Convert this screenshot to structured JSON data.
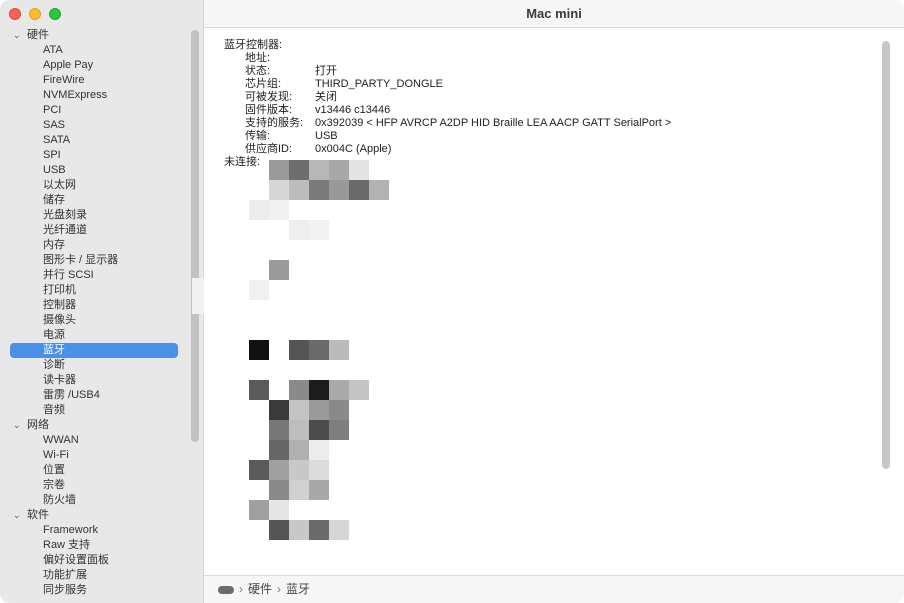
{
  "window": {
    "title": "Mac mini"
  },
  "sidebar": {
    "rows": [
      {
        "type": "group",
        "label": "硬件",
        "name": "sidebar-group-hardware"
      },
      {
        "type": "item",
        "label": "ATA",
        "name": "sidebar-item-ata"
      },
      {
        "type": "item",
        "label": "Apple Pay",
        "name": "sidebar-item-apple-pay"
      },
      {
        "type": "item",
        "label": "FireWire",
        "name": "sidebar-item-firewire"
      },
      {
        "type": "item",
        "label": "NVMExpress",
        "name": "sidebar-item-nvmexpress"
      },
      {
        "type": "item",
        "label": "PCI",
        "name": "sidebar-item-pci"
      },
      {
        "type": "item",
        "label": "SAS",
        "name": "sidebar-item-sas"
      },
      {
        "type": "item",
        "label": "SATA",
        "name": "sidebar-item-sata"
      },
      {
        "type": "item",
        "label": "SPI",
        "name": "sidebar-item-spi"
      },
      {
        "type": "item",
        "label": "USB",
        "name": "sidebar-item-usb"
      },
      {
        "type": "item",
        "label": "以太网",
        "name": "sidebar-item-ethernet"
      },
      {
        "type": "item",
        "label": "储存",
        "name": "sidebar-item-storage"
      },
      {
        "type": "item",
        "label": "光盘刻录",
        "name": "sidebar-item-disc-burning"
      },
      {
        "type": "item",
        "label": "光纤通道",
        "name": "sidebar-item-fibre-channel"
      },
      {
        "type": "item",
        "label": "内存",
        "name": "sidebar-item-memory"
      },
      {
        "type": "item",
        "label": "图形卡 / 显示器",
        "name": "sidebar-item-graphics"
      },
      {
        "type": "item",
        "label": "并行 SCSI",
        "name": "sidebar-item-parallel-scsi"
      },
      {
        "type": "item",
        "label": "打印机",
        "name": "sidebar-item-printers"
      },
      {
        "type": "item",
        "label": "控制器",
        "name": "sidebar-item-controller"
      },
      {
        "type": "item",
        "label": "摄像头",
        "name": "sidebar-item-camera"
      },
      {
        "type": "item",
        "label": "电源",
        "name": "sidebar-item-power"
      },
      {
        "type": "item",
        "label": "蓝牙",
        "name": "sidebar-item-bluetooth",
        "selected": true
      },
      {
        "type": "item",
        "label": "诊断",
        "name": "sidebar-item-diagnostics"
      },
      {
        "type": "item",
        "label": "读卡器",
        "name": "sidebar-item-card-reader"
      },
      {
        "type": "item",
        "label": "雷雳 /USB4",
        "name": "sidebar-item-thunderbolt"
      },
      {
        "type": "item",
        "label": "音频",
        "name": "sidebar-item-audio"
      },
      {
        "type": "group",
        "label": "网络",
        "name": "sidebar-group-network"
      },
      {
        "type": "item",
        "label": "WWAN",
        "name": "sidebar-item-wwan"
      },
      {
        "type": "item",
        "label": "Wi-Fi",
        "name": "sidebar-item-wifi"
      },
      {
        "type": "item",
        "label": "位置",
        "name": "sidebar-item-locations"
      },
      {
        "type": "item",
        "label": "宗卷",
        "name": "sidebar-item-volumes"
      },
      {
        "type": "item",
        "label": "防火墙",
        "name": "sidebar-item-firewall"
      },
      {
        "type": "group",
        "label": "软件",
        "name": "sidebar-group-software"
      },
      {
        "type": "item",
        "label": "Framework",
        "name": "sidebar-item-framework"
      },
      {
        "type": "item",
        "label": "Raw 支持",
        "name": "sidebar-item-raw-support"
      },
      {
        "type": "item",
        "label": "偏好设置面板",
        "name": "sidebar-item-prefpanes"
      },
      {
        "type": "item",
        "label": "功能扩展",
        "name": "sidebar-item-extensions"
      },
      {
        "type": "item",
        "label": "同步服务",
        "name": "sidebar-item-sync-services"
      }
    ]
  },
  "detail": {
    "section_label": "蓝牙控制器:",
    "fields": [
      {
        "key": "地址:",
        "value": ""
      },
      {
        "key": "状态:",
        "value": "打开"
      },
      {
        "key": "芯片组:",
        "value": "THIRD_PARTY_DONGLE"
      },
      {
        "key": "可被发现:",
        "value": "关闭"
      },
      {
        "key": "固件版本:",
        "value": "v13446 c13446"
      },
      {
        "key": "支持的服务:",
        "value": "0x392039 < HFP AVRCP A2DP HID Braille LEA AACP GATT SerialPort >"
      },
      {
        "key": "传输:",
        "value": "USB"
      },
      {
        "key": "供应商ID:",
        "value": "0x004C (Apple)"
      }
    ],
    "not_connected_label": "未连接:"
  },
  "breadcrumb": {
    "items": [
      "硬件",
      "蓝牙"
    ],
    "separator": "›"
  }
}
